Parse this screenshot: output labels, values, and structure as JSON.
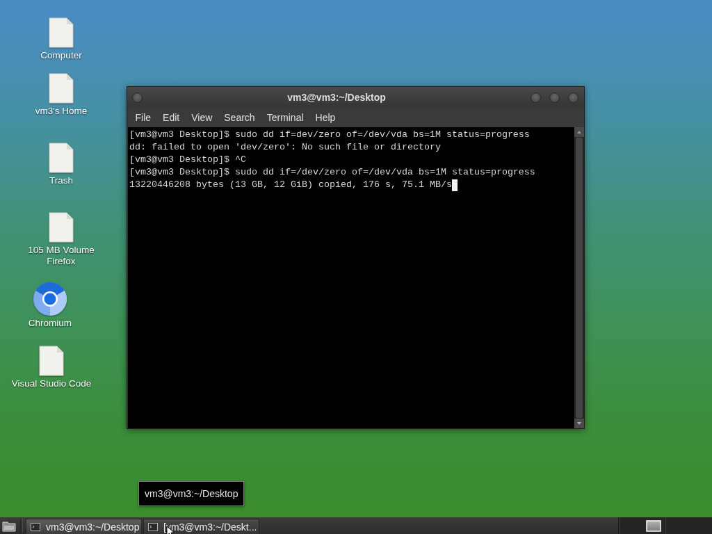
{
  "desktop": {
    "icons": [
      {
        "label": "Computer",
        "kind": "file"
      },
      {
        "label": "vm3's Home",
        "kind": "file"
      },
      {
        "label": "Trash",
        "kind": "file"
      },
      {
        "label": "105 MB Volume",
        "kind": "file",
        "overlaid_label": "Firefox"
      },
      {
        "label": "Chromium",
        "kind": "chromium"
      },
      {
        "label": "Visual Studio Code",
        "kind": "file"
      }
    ]
  },
  "terminal_window": {
    "title": "vm3@vm3:~/Desktop",
    "menu": [
      "File",
      "Edit",
      "View",
      "Search",
      "Terminal",
      "Help"
    ],
    "lines": [
      "[vm3@vm3 Desktop]$ sudo dd if=dev/zero of=/dev/vda bs=1M status=progress",
      "dd: failed to open 'dev/zero': No such file or directory",
      "[vm3@vm3 Desktop]$ ^C",
      "[vm3@vm3 Desktop]$ sudo dd if=/dev/zero of=/dev/vda bs=1M status=progress",
      "13220446208 bytes (13 GB, 12 GiB) copied, 176 s, 75.1 MB/s"
    ],
    "cursor": true
  },
  "tooltip": {
    "text": "vm3@vm3:~/Desktop"
  },
  "taskbar": {
    "tasks": [
      {
        "label": "vm3@vm3:~/Desktop",
        "selected": true
      },
      {
        "label": "[vm3@vm3:~/Deskt...",
        "selected": false
      }
    ]
  }
}
